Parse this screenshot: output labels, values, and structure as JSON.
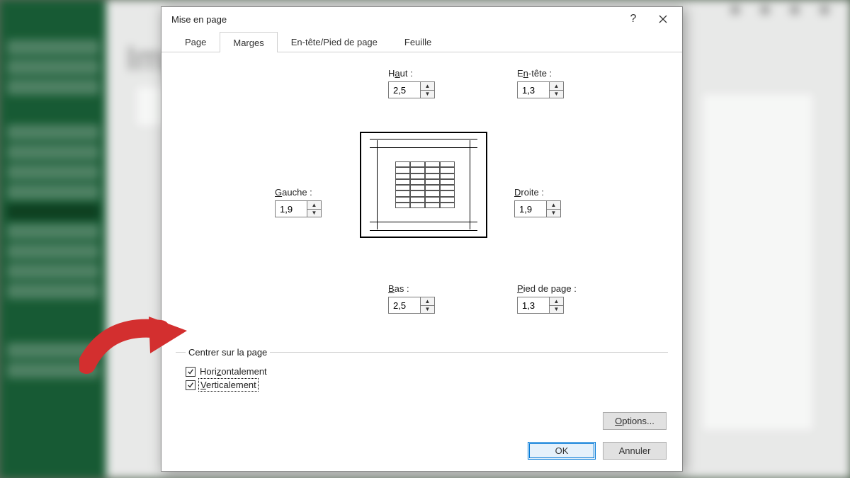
{
  "dialog": {
    "title": "Mise en page",
    "tabs": {
      "page": "Page",
      "marges": "Marges",
      "entete": "En-tête/Pied de page",
      "feuille": "Feuille"
    },
    "margins": {
      "haut": {
        "label_pre": "H",
        "label_u": "a",
        "label_post": "ut :",
        "value": "2,5"
      },
      "entete": {
        "label_pre": "E",
        "label_u": "n",
        "label_post": "-tête :",
        "value": "1,3"
      },
      "gauche": {
        "label_pre": "",
        "label_u": "G",
        "label_post": "auche :",
        "value": "1,9"
      },
      "droite": {
        "label_pre": "",
        "label_u": "D",
        "label_post": "roite :",
        "value": "1,9"
      },
      "bas": {
        "label_pre": "",
        "label_u": "B",
        "label_post": "as :",
        "value": "2,5"
      },
      "pied": {
        "label_pre": "",
        "label_u": "P",
        "label_post": "ied de page :",
        "value": "1,3"
      }
    },
    "center_group": {
      "legend": "Centrer sur la page",
      "horizontal_pre": "Hori",
      "horizontal_u": "z",
      "horizontal_post": "ontalement",
      "vertical_pre": "",
      "vertical_u": "V",
      "vertical_post": "erticalement"
    },
    "buttons": {
      "options_pre": "",
      "options_u": "O",
      "options_post": "ptions...",
      "ok": "OK",
      "cancel": "Annuler"
    }
  },
  "bg_title": "Imp"
}
